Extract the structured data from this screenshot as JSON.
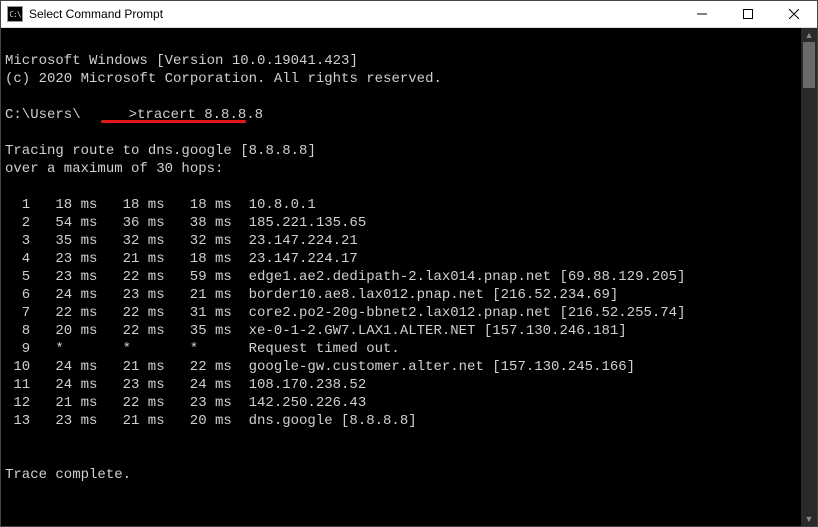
{
  "window": {
    "title": "Select Command Prompt"
  },
  "banner": {
    "line1": "Microsoft Windows [Version 10.0.19041.423]",
    "line2": "(c) 2020 Microsoft Corporation. All rights reserved."
  },
  "prompt": {
    "prefix": "C:\\Users\\",
    "suffix": ">",
    "command": "tracert 8.8.8.8"
  },
  "trace": {
    "heading1": "Tracing route to dns.google [8.8.8.8]",
    "heading2": "over a maximum of 30 hops:",
    "complete": "Trace complete."
  },
  "hops": [
    {
      "n": "1",
      "t1": "18 ms",
      "t2": "18 ms",
      "t3": "18 ms",
      "dest": "10.8.0.1"
    },
    {
      "n": "2",
      "t1": "54 ms",
      "t2": "36 ms",
      "t3": "38 ms",
      "dest": "185.221.135.65"
    },
    {
      "n": "3",
      "t1": "35 ms",
      "t2": "32 ms",
      "t3": "32 ms",
      "dest": "23.147.224.21"
    },
    {
      "n": "4",
      "t1": "23 ms",
      "t2": "21 ms",
      "t3": "18 ms",
      "dest": "23.147.224.17"
    },
    {
      "n": "5",
      "t1": "23 ms",
      "t2": "22 ms",
      "t3": "59 ms",
      "dest": "edge1.ae2.dedipath-2.lax014.pnap.net [69.88.129.205]"
    },
    {
      "n": "6",
      "t1": "24 ms",
      "t2": "23 ms",
      "t3": "21 ms",
      "dest": "border10.ae8.lax012.pnap.net [216.52.234.69]"
    },
    {
      "n": "7",
      "t1": "22 ms",
      "t2": "22 ms",
      "t3": "31 ms",
      "dest": "core2.po2-20g-bbnet2.lax012.pnap.net [216.52.255.74]"
    },
    {
      "n": "8",
      "t1": "20 ms",
      "t2": "22 ms",
      "t3": "35 ms",
      "dest": "xe-0-1-2.GW7.LAX1.ALTER.NET [157.130.246.181]"
    },
    {
      "n": "9",
      "t1": "*    ",
      "t2": "*    ",
      "t3": "*    ",
      "dest": "Request timed out."
    },
    {
      "n": "10",
      "t1": "24 ms",
      "t2": "21 ms",
      "t3": "22 ms",
      "dest": "google-gw.customer.alter.net [157.130.245.166]"
    },
    {
      "n": "11",
      "t1": "24 ms",
      "t2": "23 ms",
      "t3": "24 ms",
      "dest": "108.170.238.52"
    },
    {
      "n": "12",
      "t1": "21 ms",
      "t2": "22 ms",
      "t3": "23 ms",
      "dest": "142.250.226.43"
    },
    {
      "n": "13",
      "t1": "23 ms",
      "t2": "21 ms",
      "t3": "20 ms",
      "dest": "dns.google [8.8.8.8]"
    }
  ]
}
